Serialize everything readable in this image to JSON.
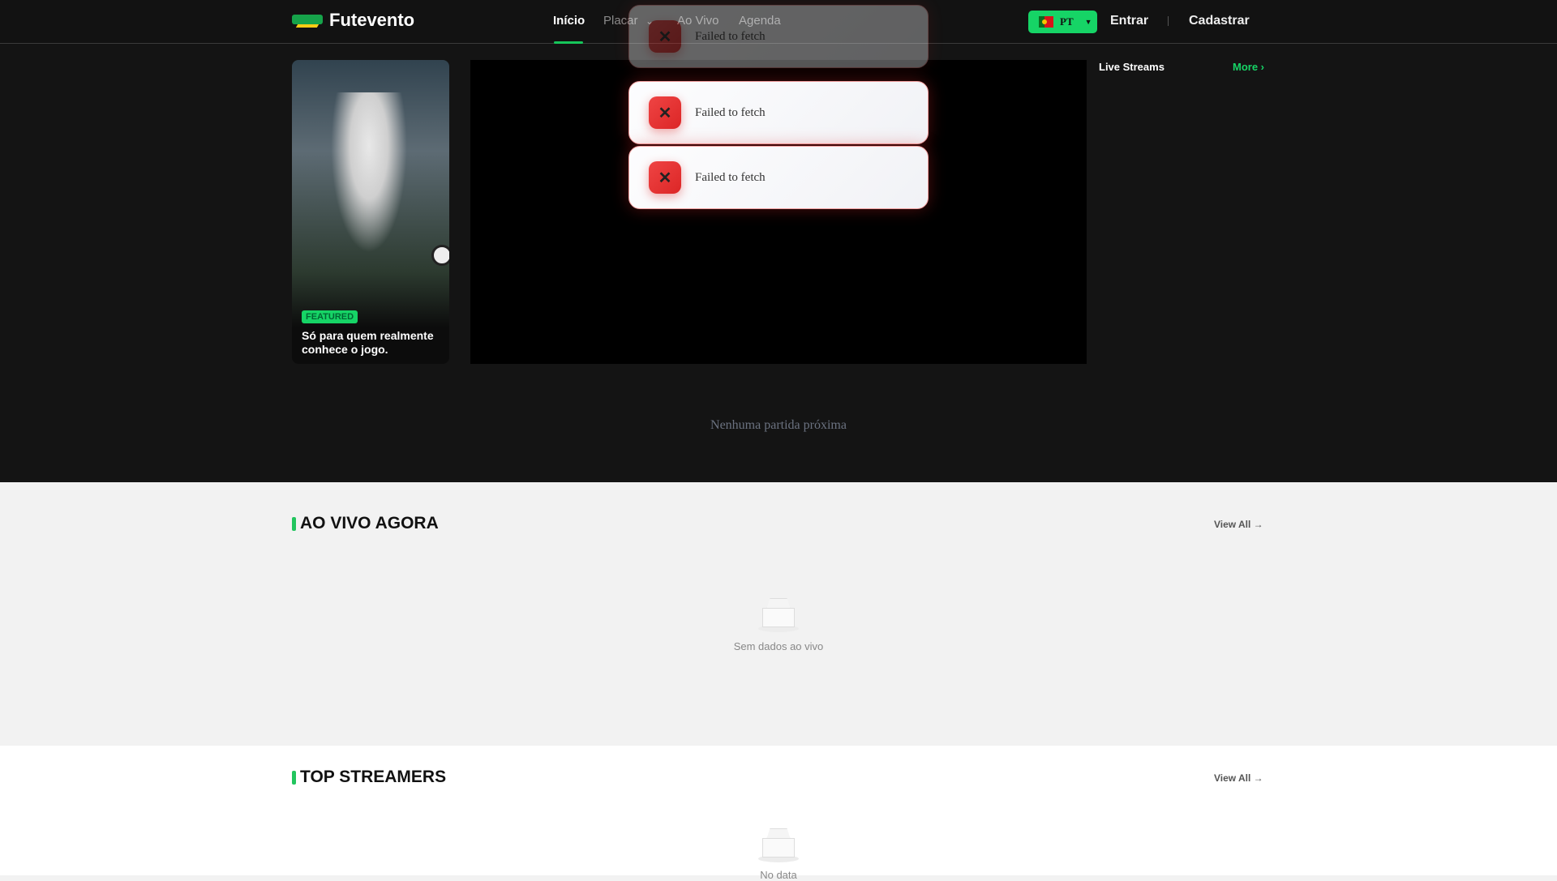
{
  "header": {
    "brand": "Futevento",
    "nav": [
      "Início",
      "Placar",
      "Ao Vivo",
      "Agenda"
    ],
    "language": "PT",
    "login": "Entrar",
    "register": "Cadastrar"
  },
  "banner": {
    "badge": "FEATURED",
    "title": "Só para quem realmente conhece o jogo."
  },
  "live_streams": {
    "title": "Live Streams",
    "more": "More ›"
  },
  "toasts": [
    "Failed to fetch",
    "Failed to fetch",
    "Failed to fetch"
  ],
  "upcoming_empty": "Nenhuma partida próxima",
  "live_now": {
    "title": "AO VIVO AGORA",
    "view_all": "View All →",
    "empty": "Sem dados ao vivo"
  },
  "top_streamers": {
    "title": "TOP STREAMERS",
    "view_all": "View All →",
    "empty": "No data"
  },
  "colors": {
    "accent": "#16d466",
    "error": "#dc2626"
  }
}
